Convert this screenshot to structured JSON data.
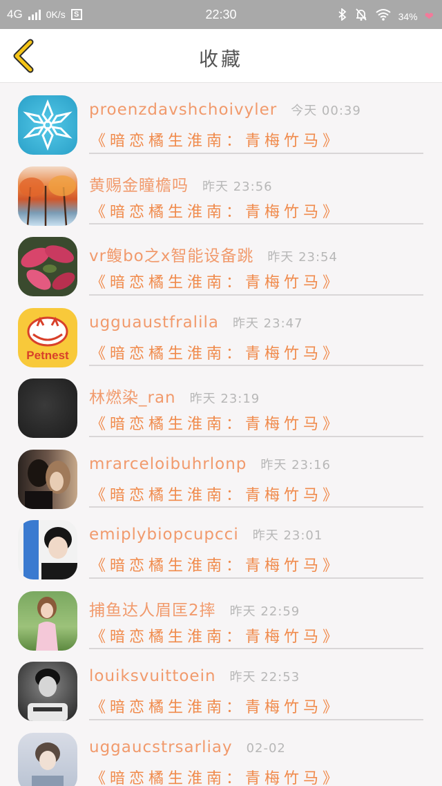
{
  "status_bar": {
    "network": "4G",
    "speed": "0K/s",
    "time": "22:30",
    "battery": "34%",
    "icons": [
      "signal-icon",
      "sim-icon",
      "bluetooth-icon",
      "alarm-off-icon",
      "wifi-icon",
      "heart-icon"
    ]
  },
  "header": {
    "title": "收藏",
    "back_icon": "chevron-left-icon",
    "accent_color": "#f5c518"
  },
  "colors": {
    "name": "#f19a6c",
    "book": "#f08a4b",
    "time": "#b7b7b7"
  },
  "items": [
    {
      "name": "proenzdavshchoivyler",
      "time": "今天 00:39",
      "book": "《暗恋橘生淮南：青梅竹马》",
      "avatar": "snowflake"
    },
    {
      "name": "黄赐金瞳檐吗",
      "time": "昨天 23:56",
      "book": "《暗恋橘生淮南：青梅竹马》",
      "avatar": "autumn-trees"
    },
    {
      "name": "vr鳆bo之x智能设备跳",
      "time": "昨天 23:54",
      "book": "《暗恋橘生淮南：青梅竹马》",
      "avatar": "red-leaves"
    },
    {
      "name": "ugguaustfralila",
      "time": "昨天 23:47",
      "book": "《暗恋橘生淮南：青梅竹马》",
      "avatar": "petnest",
      "avatar_text": "Petnest"
    },
    {
      "name": "林燃染_ran",
      "time": "昨天 23:19",
      "book": "《暗恋橘生淮南：青梅竹马》",
      "avatar": "dark"
    },
    {
      "name": "mrarceloibuhrlonp",
      "time": "昨天 23:16",
      "book": "《暗恋橘生淮南：青梅竹马》",
      "avatar": "couple"
    },
    {
      "name": "emiplybiopcupcci",
      "time": "昨天 23:01",
      "book": "《暗恋橘生淮南：青梅竹马》",
      "avatar": "boy-portrait"
    },
    {
      "name": "捕鱼达人眉匡2摔",
      "time": "昨天 22:59",
      "book": "《暗恋橘生淮南：青梅竹马》",
      "avatar": "girl-garden"
    },
    {
      "name": "louiksvuittoein",
      "time": "昨天 22:53",
      "book": "《暗恋橘生淮南：青梅竹马》",
      "avatar": "bw-man"
    },
    {
      "name": "uggaucstrsarliay",
      "time": "02-02",
      "book": "《暗恋橘生淮南：青梅竹马》",
      "avatar": "soft-portrait"
    }
  ]
}
